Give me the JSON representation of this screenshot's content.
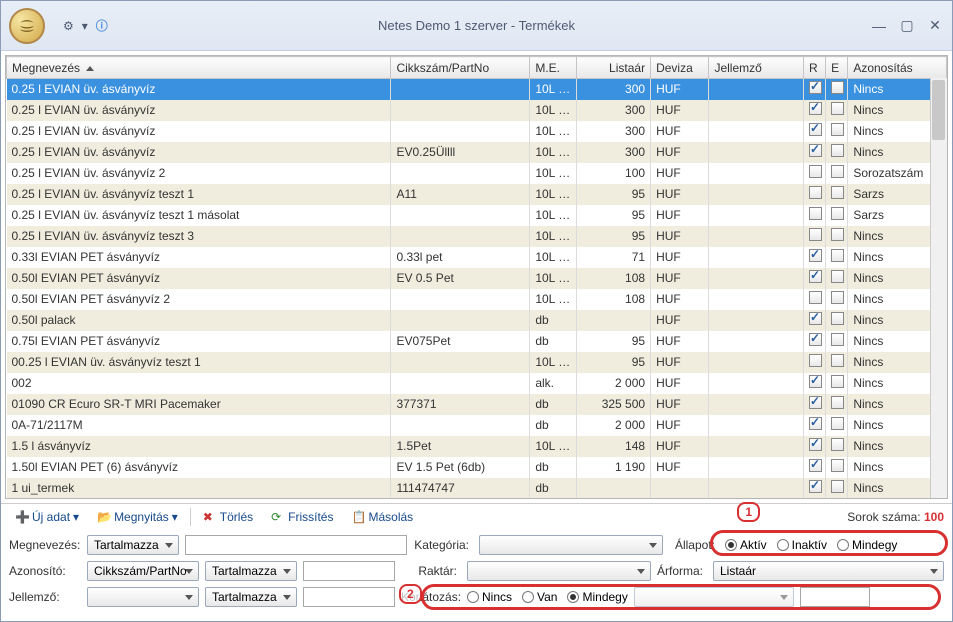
{
  "title": "Netes Demo 1 szerver - Termékek",
  "columns": [
    "Megnevezés",
    "Cikkszám/PartNo",
    "M.E.",
    "Listaár",
    "Deviza",
    "Jellemző",
    "R",
    "E",
    "Azonosítás"
  ],
  "rows": [
    {
      "n": "0.25 l EVIAN üv. ásványvíz",
      "c": "",
      "m": "10L …",
      "p": "300",
      "d": "HUF",
      "j": "",
      "r": true,
      "e": false,
      "a": "Nincs",
      "sel": true
    },
    {
      "n": "0.25 l EVIAN üv. ásványvíz",
      "c": "",
      "m": "10L …",
      "p": "300",
      "d": "HUF",
      "j": "",
      "r": true,
      "e": false,
      "a": "Nincs"
    },
    {
      "n": "0.25 l EVIAN üv. ásványvíz",
      "c": "",
      "m": "10L …",
      "p": "300",
      "d": "HUF",
      "j": "",
      "r": true,
      "e": false,
      "a": "Nincs"
    },
    {
      "n": "0.25 l EVIAN üv. ásványvíz",
      "c": "EV0.25Üllll",
      "m": "10L …",
      "p": "300",
      "d": "HUF",
      "j": "",
      "r": true,
      "e": false,
      "a": "Nincs"
    },
    {
      "n": "0.25 l EVIAN üv. ásványvíz 2",
      "c": "",
      "m": "10L …",
      "p": "100",
      "d": "HUF",
      "j": "",
      "r": false,
      "e": false,
      "a": "Sorozatszám"
    },
    {
      "n": "0.25 l EVIAN üv. ásványvíz teszt 1",
      "c": "A11",
      "m": "10L …",
      "p": "95",
      "d": "HUF",
      "j": "",
      "r": false,
      "e": false,
      "a": "Sarzs"
    },
    {
      "n": "0.25 l EVIAN üv. ásványvíz teszt 1 másolat",
      "c": "",
      "m": "10L …",
      "p": "95",
      "d": "HUF",
      "j": "",
      "r": false,
      "e": false,
      "a": "Sarzs"
    },
    {
      "n": "0.25 l EVIAN üv. ásványvíz teszt 3",
      "c": "",
      "m": "10L …",
      "p": "95",
      "d": "HUF",
      "j": "",
      "r": false,
      "e": false,
      "a": "Nincs"
    },
    {
      "n": "0.33l EVIAN PET ásványvíz",
      "c": "0.33l pet",
      "m": "10L …",
      "p": "71",
      "d": "HUF",
      "j": "",
      "r": true,
      "e": false,
      "a": "Nincs"
    },
    {
      "n": "0.50l EVIAN PET ásványvíz",
      "c": "EV 0.5  Pet",
      "m": "10L …",
      "p": "108",
      "d": "HUF",
      "j": "",
      "r": true,
      "e": false,
      "a": "Nincs"
    },
    {
      "n": "0.50l EVIAN PET ásványvíz 2",
      "c": "",
      "m": "10L …",
      "p": "108",
      "d": "HUF",
      "j": "",
      "r": false,
      "e": false,
      "a": "Nincs"
    },
    {
      "n": "0.50l palack",
      "c": "",
      "m": "db",
      "p": "",
      "d": "HUF",
      "j": "",
      "r": true,
      "e": false,
      "a": "Nincs"
    },
    {
      "n": "0.75l EVIAN PET ásványvíz",
      "c": "EV075Pet",
      "m": "db",
      "p": "95",
      "d": "HUF",
      "j": "",
      "r": true,
      "e": false,
      "a": "Nincs"
    },
    {
      "n": "00.25 l EVIAN üv. ásványvíz teszt 1",
      "c": "",
      "m": "10L …",
      "p": "95",
      "d": "HUF",
      "j": "",
      "r": false,
      "e": false,
      "a": "Nincs"
    },
    {
      "n": "002",
      "c": "",
      "m": "alk.",
      "p": "2 000",
      "d": "HUF",
      "j": "",
      "r": true,
      "e": false,
      "a": "Nincs"
    },
    {
      "n": "01090 CR Ecuro SR-T MRI Pacemaker",
      "c": "377371",
      "m": "db",
      "p": "325 500",
      "d": "HUF",
      "j": "",
      "r": true,
      "e": false,
      "a": "Nincs"
    },
    {
      "n": "0A-71/2117M",
      "c": "",
      "m": "db",
      "p": "2 000",
      "d": "HUF",
      "j": "",
      "r": true,
      "e": false,
      "a": "Nincs"
    },
    {
      "n": "1.5 l ásványvíz",
      "c": "1.5Pet",
      "m": "10L …",
      "p": "148",
      "d": "HUF",
      "j": "",
      "r": true,
      "e": false,
      "a": "Nincs"
    },
    {
      "n": "1.50l EVIAN PET (6) ásványvíz",
      "c": "EV 1.5 Pet (6db)",
      "m": "db",
      "p": "1 190",
      "d": "HUF",
      "j": "",
      "r": true,
      "e": false,
      "a": "Nincs"
    },
    {
      "n": "1 ui_termek",
      "c": "111474747",
      "m": "db",
      "p": "",
      "d": "",
      "j": "",
      "r": true,
      "e": false,
      "a": "Nincs"
    }
  ],
  "toolbar": {
    "uj": "Új adat",
    "meg": "Megnyitás",
    "tor": "Törlés",
    "fri": "Frissítés",
    "mas": "Másolás"
  },
  "sorok_lbl": "Sorok száma:",
  "sorok_val": "100",
  "marker1": "1",
  "marker2": "2",
  "filters": {
    "megnevezes": "Megnevezés:",
    "azonosito": "Azonosító:",
    "jellemzo": "Jellemző:",
    "kategoria": "Kategória:",
    "raktar": "Raktár:",
    "korlatozas": "Korlátozás:",
    "allapot": "Állapot:",
    "arforma": "Árforma:",
    "tartalmazza": "Tartalmazza",
    "cikkszam": "Cikkszám/PartNo",
    "listaar": "Listaár",
    "aktiv": "Aktív",
    "inaktiv": "Inaktív",
    "mindegy": "Mindegy",
    "nincs": "Nincs",
    "van": "Van"
  }
}
